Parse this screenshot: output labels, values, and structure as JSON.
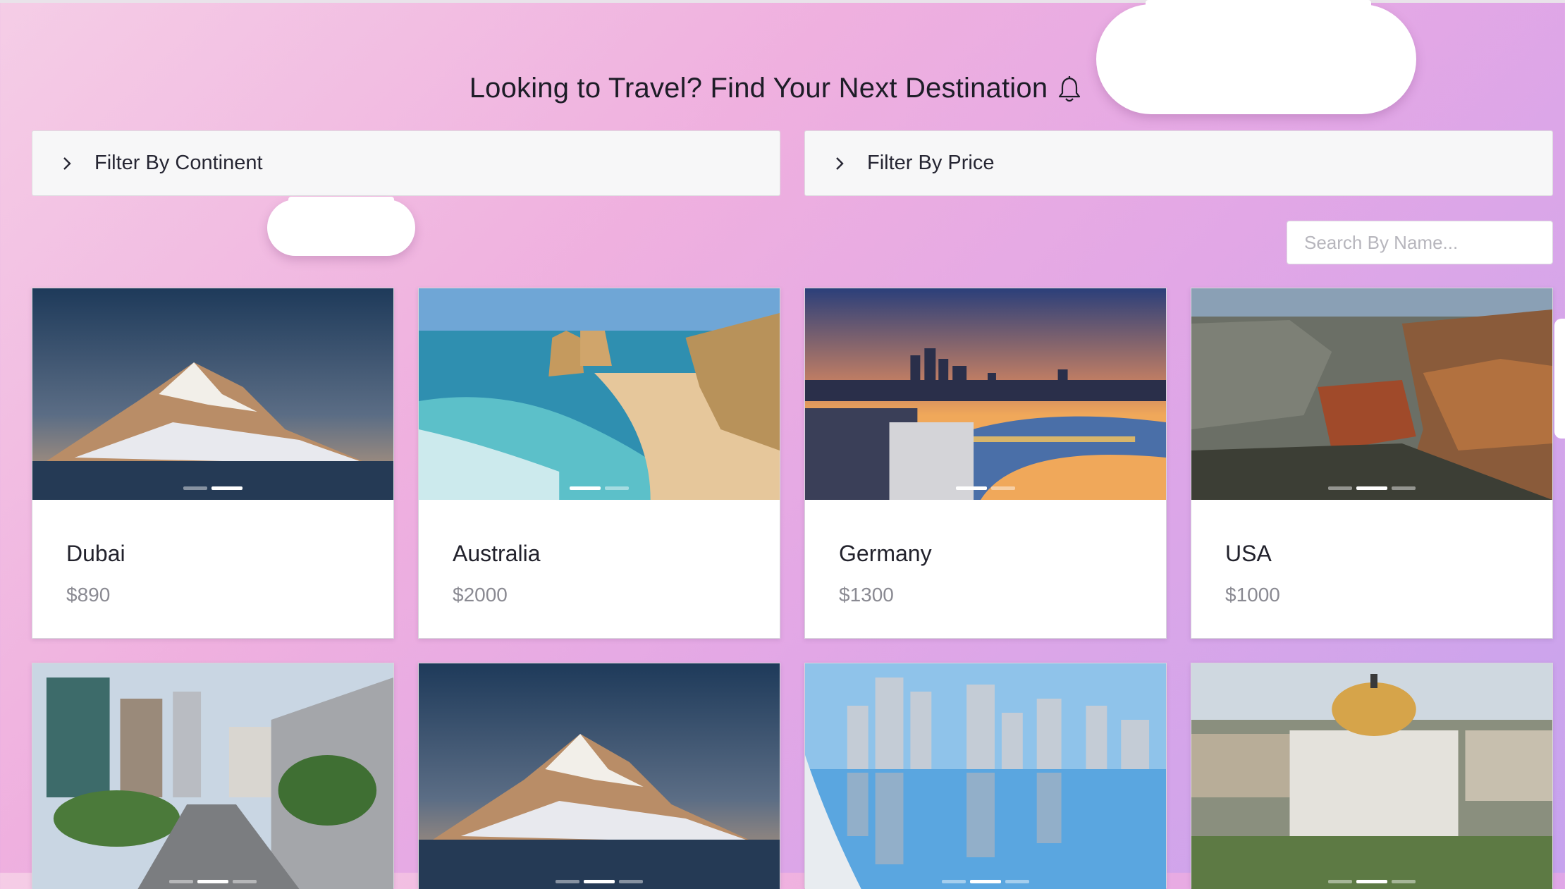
{
  "header": {
    "title": "Looking to Travel? Find Your Next Destination"
  },
  "filters": {
    "continent_label": "Filter By Continent",
    "price_label": "Filter By Price"
  },
  "search": {
    "placeholder": "Search By Name..."
  },
  "destinations": [
    {
      "name": "Dubai",
      "price": "$890",
      "image": "snowy-mountain-at-sunset"
    },
    {
      "name": "Australia",
      "price": "$2000",
      "image": "coastal-cliffs-and-beach"
    },
    {
      "name": "Germany",
      "price": "$1300",
      "image": "city-skyline-river-at-dusk"
    },
    {
      "name": "USA",
      "price": "$1000",
      "image": "grand-canyon"
    }
  ],
  "destinations_row2_images": [
    "city-street-with-skyscrapers",
    "snowy-mountain-at-sunset",
    "skyscrapers-reflected-in-water",
    "domed-palace-and-plaza"
  ],
  "colors": {
    "background_gradient": [
      "#f5cde6",
      "#efb0df",
      "#e2a7e6",
      "#c6a3ee"
    ],
    "text_dark": "#1d1d27",
    "price_gray": "#8a8a92"
  }
}
